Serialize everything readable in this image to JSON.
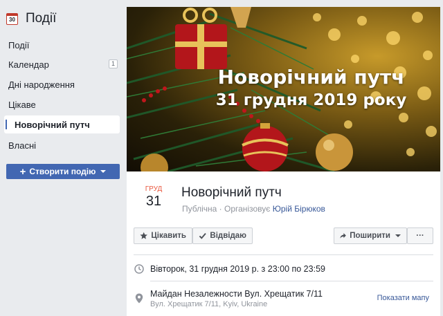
{
  "sidebar": {
    "header_title": "Події",
    "calendar_icon_day": "30",
    "items": [
      {
        "label": "Події"
      },
      {
        "label": "Календар",
        "badge": "1"
      },
      {
        "label": "Дні народження"
      },
      {
        "label": "Цікаве"
      },
      {
        "label": "Новорічний путч",
        "active": true
      },
      {
        "label": "Власні"
      }
    ],
    "create_button": "Створити подію"
  },
  "event": {
    "cover_line1": "Новорічний путч",
    "cover_line2": "31 грудня 2019 року",
    "month": "ГРУД",
    "day": "31",
    "title": "Новорічний путч",
    "privacy": "Публічна",
    "organized_by_prefix": "Організовує",
    "organizer": "Юрій Бірюков",
    "buttons": {
      "interested": "Цікавить",
      "going": "Відвідаю",
      "share": "Поширити",
      "more": "···"
    },
    "datetime": "Вівторок, 31 грудня 2019 р. з 23:00 по 23:59",
    "location_name": "Майдан Незалежности Вул. Хрещатик 7/11",
    "location_address": "Вул. Хрещатик 7/11, Kyiv, Ukraine",
    "show_map": "Показати мапу"
  },
  "colors": {
    "accent": "#4267b2",
    "link": "#385898",
    "month_red": "#e9573e",
    "background": "#e9ebee"
  }
}
